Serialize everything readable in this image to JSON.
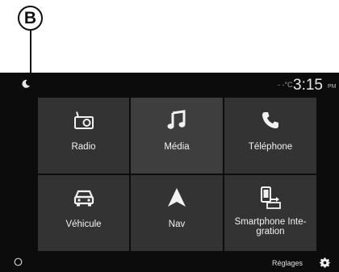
{
  "callout": {
    "letter": "B"
  },
  "status_bar": {
    "night_mode_icon": "moon-icon",
    "temperature": "- -°C",
    "time": "3:15",
    "ampm": "PM"
  },
  "tiles": [
    {
      "label": "Radio",
      "icon": "radio-icon"
    },
    {
      "label": "Média",
      "icon": "music-note-icon"
    },
    {
      "label": "Téléphone",
      "icon": "phone-icon"
    },
    {
      "label": "Véhicule",
      "icon": "car-icon"
    },
    {
      "label": "Nav",
      "icon": "navigation-arrow-icon"
    },
    {
      "label": "Smartphone Inte-\ngration",
      "icon": "smartphone-integration-icon"
    }
  ],
  "bottom_bar": {
    "left_icon": "circle-icon",
    "settings_label": "Réglages",
    "settings_icon": "gear-icon"
  }
}
